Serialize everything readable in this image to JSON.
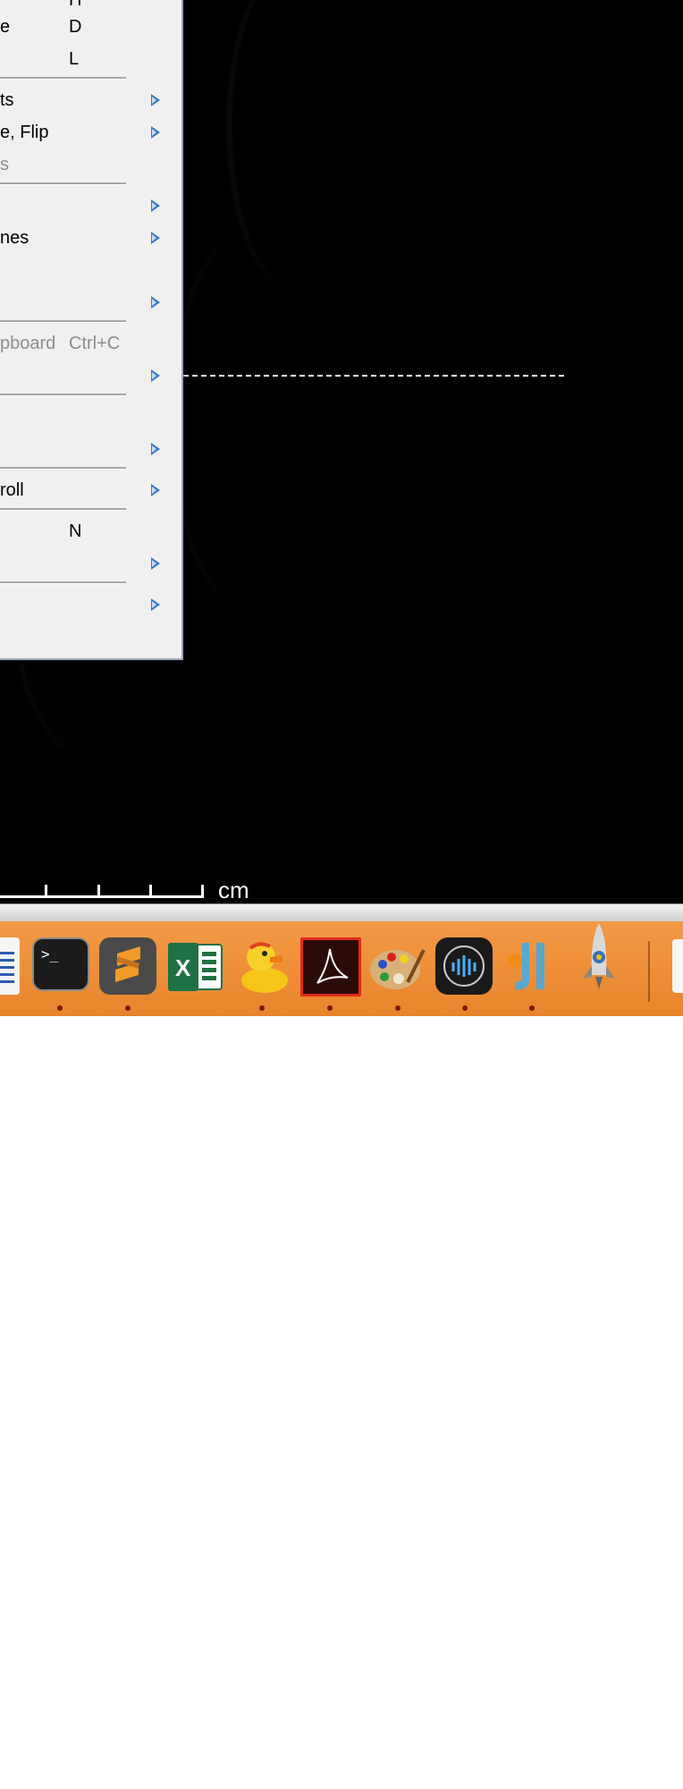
{
  "menu": {
    "items": [
      {
        "label": "",
        "shortcut": "H",
        "submenu": false,
        "disabled": false
      },
      {
        "label": "e",
        "shortcut": "D",
        "submenu": false,
        "disabled": false
      },
      {
        "label": "",
        "shortcut": "L",
        "submenu": false,
        "disabled": false
      },
      {
        "label": "ts",
        "shortcut": "",
        "submenu": true,
        "disabled": false
      },
      {
        "label": "e, Flip",
        "shortcut": "",
        "submenu": true,
        "disabled": false
      },
      {
        "label": "s",
        "shortcut": "",
        "submenu": false,
        "disabled": true
      },
      {
        "label": "",
        "shortcut": "",
        "submenu": true,
        "disabled": false
      },
      {
        "label": "nes",
        "shortcut": "",
        "submenu": true,
        "disabled": false
      },
      {
        "label": "",
        "shortcut": "",
        "submenu": true,
        "disabled": false
      },
      {
        "label": "pboard",
        "shortcut": "Ctrl+C",
        "submenu": false,
        "disabled": true
      },
      {
        "label": "",
        "shortcut": "",
        "submenu": true,
        "disabled": false
      },
      {
        "label": "",
        "shortcut": "",
        "submenu": false,
        "disabled": false
      },
      {
        "label": "",
        "shortcut": "",
        "submenu": true,
        "disabled": false
      },
      {
        "label": "roll",
        "shortcut": "",
        "submenu": true,
        "disabled": false
      },
      {
        "label": "",
        "shortcut": "N",
        "submenu": false,
        "disabled": false
      },
      {
        "label": "",
        "shortcut": "",
        "submenu": true,
        "disabled": false
      },
      {
        "label": "",
        "shortcut": "",
        "submenu": true,
        "disabled": false
      }
    ]
  },
  "image": {
    "scale_unit": "cm"
  },
  "dock": {
    "icons": [
      {
        "name": "text-editor-icon",
        "running": false
      },
      {
        "name": "terminal-icon",
        "running": true
      },
      {
        "name": "sublime-text-icon",
        "running": true
      },
      {
        "name": "excel-icon",
        "running": false
      },
      {
        "name": "cyberduck-icon",
        "running": true
      },
      {
        "name": "acrobat-reader-icon",
        "running": true
      },
      {
        "name": "paint-palette-icon",
        "running": true
      },
      {
        "name": "audio-app-icon",
        "running": true
      },
      {
        "name": "fiji-icon",
        "running": true
      },
      {
        "name": "python-rocket-icon",
        "running": false
      },
      {
        "name": "document-icon",
        "running": false
      }
    ],
    "colors": {
      "background": "#ee8c33",
      "indicator": "#7a1a0c"
    }
  }
}
